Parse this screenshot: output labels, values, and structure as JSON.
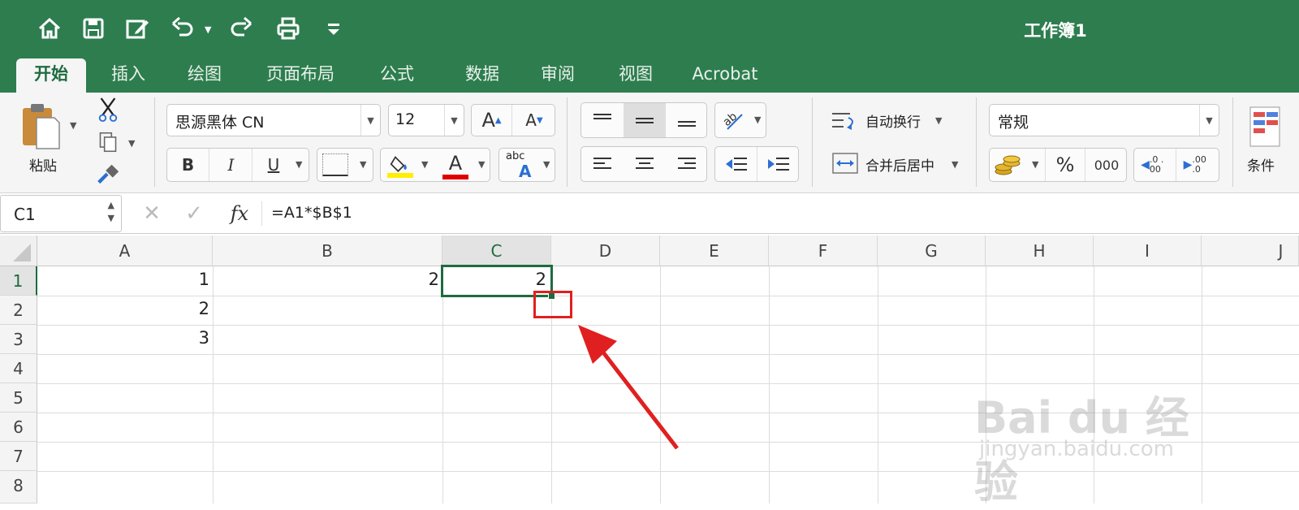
{
  "window": {
    "title": "工作簿1"
  },
  "quick_access": [
    "home-icon",
    "save-icon",
    "edit-icon",
    "undo-icon",
    "redo-icon",
    "print-icon",
    "customize-icon"
  ],
  "tabs": [
    {
      "label": "开始",
      "active": true
    },
    {
      "label": "插入"
    },
    {
      "label": "绘图"
    },
    {
      "label": "页面布局"
    },
    {
      "label": "公式"
    },
    {
      "label": "数据"
    },
    {
      "label": "审阅"
    },
    {
      "label": "视图"
    },
    {
      "label": "Acrobat"
    }
  ],
  "ribbon": {
    "paste_label": "粘贴",
    "font_name": "思源黑体 CN",
    "font_size": "12",
    "grow_font": "A",
    "shrink_font": "A",
    "bold": "B",
    "italic": "I",
    "underline": "U",
    "font_color_letter": "A",
    "abc_label": "abc",
    "wrap_text": "自动换行",
    "merge_center": "合并后居中",
    "number_format": "常规",
    "percent": "%",
    "thousands": "000",
    "dec_increase": ".0 .00",
    "dec_decrease": ".00 .0",
    "conditional": "条件",
    "highlight_color": "#ffee00",
    "font_color": "#e00000"
  },
  "formula_bar": {
    "name_box": "C1",
    "fx": "fx",
    "formula": "=A1*$B$1"
  },
  "sheet": {
    "columns": [
      "A",
      "B",
      "C",
      "D",
      "E",
      "F",
      "G",
      "H",
      "I",
      "J"
    ],
    "rows": [
      "1",
      "2",
      "3",
      "4",
      "5",
      "6",
      "7",
      "8"
    ],
    "cells": {
      "A1": "1",
      "A2": "2",
      "A3": "3",
      "B1": "2",
      "C1": "2"
    },
    "selected": "C1"
  },
  "annotation": {
    "color": "#e02020"
  },
  "watermark": {
    "brand": "Bai du 经验",
    "url": "jingyan.baidu.com"
  }
}
